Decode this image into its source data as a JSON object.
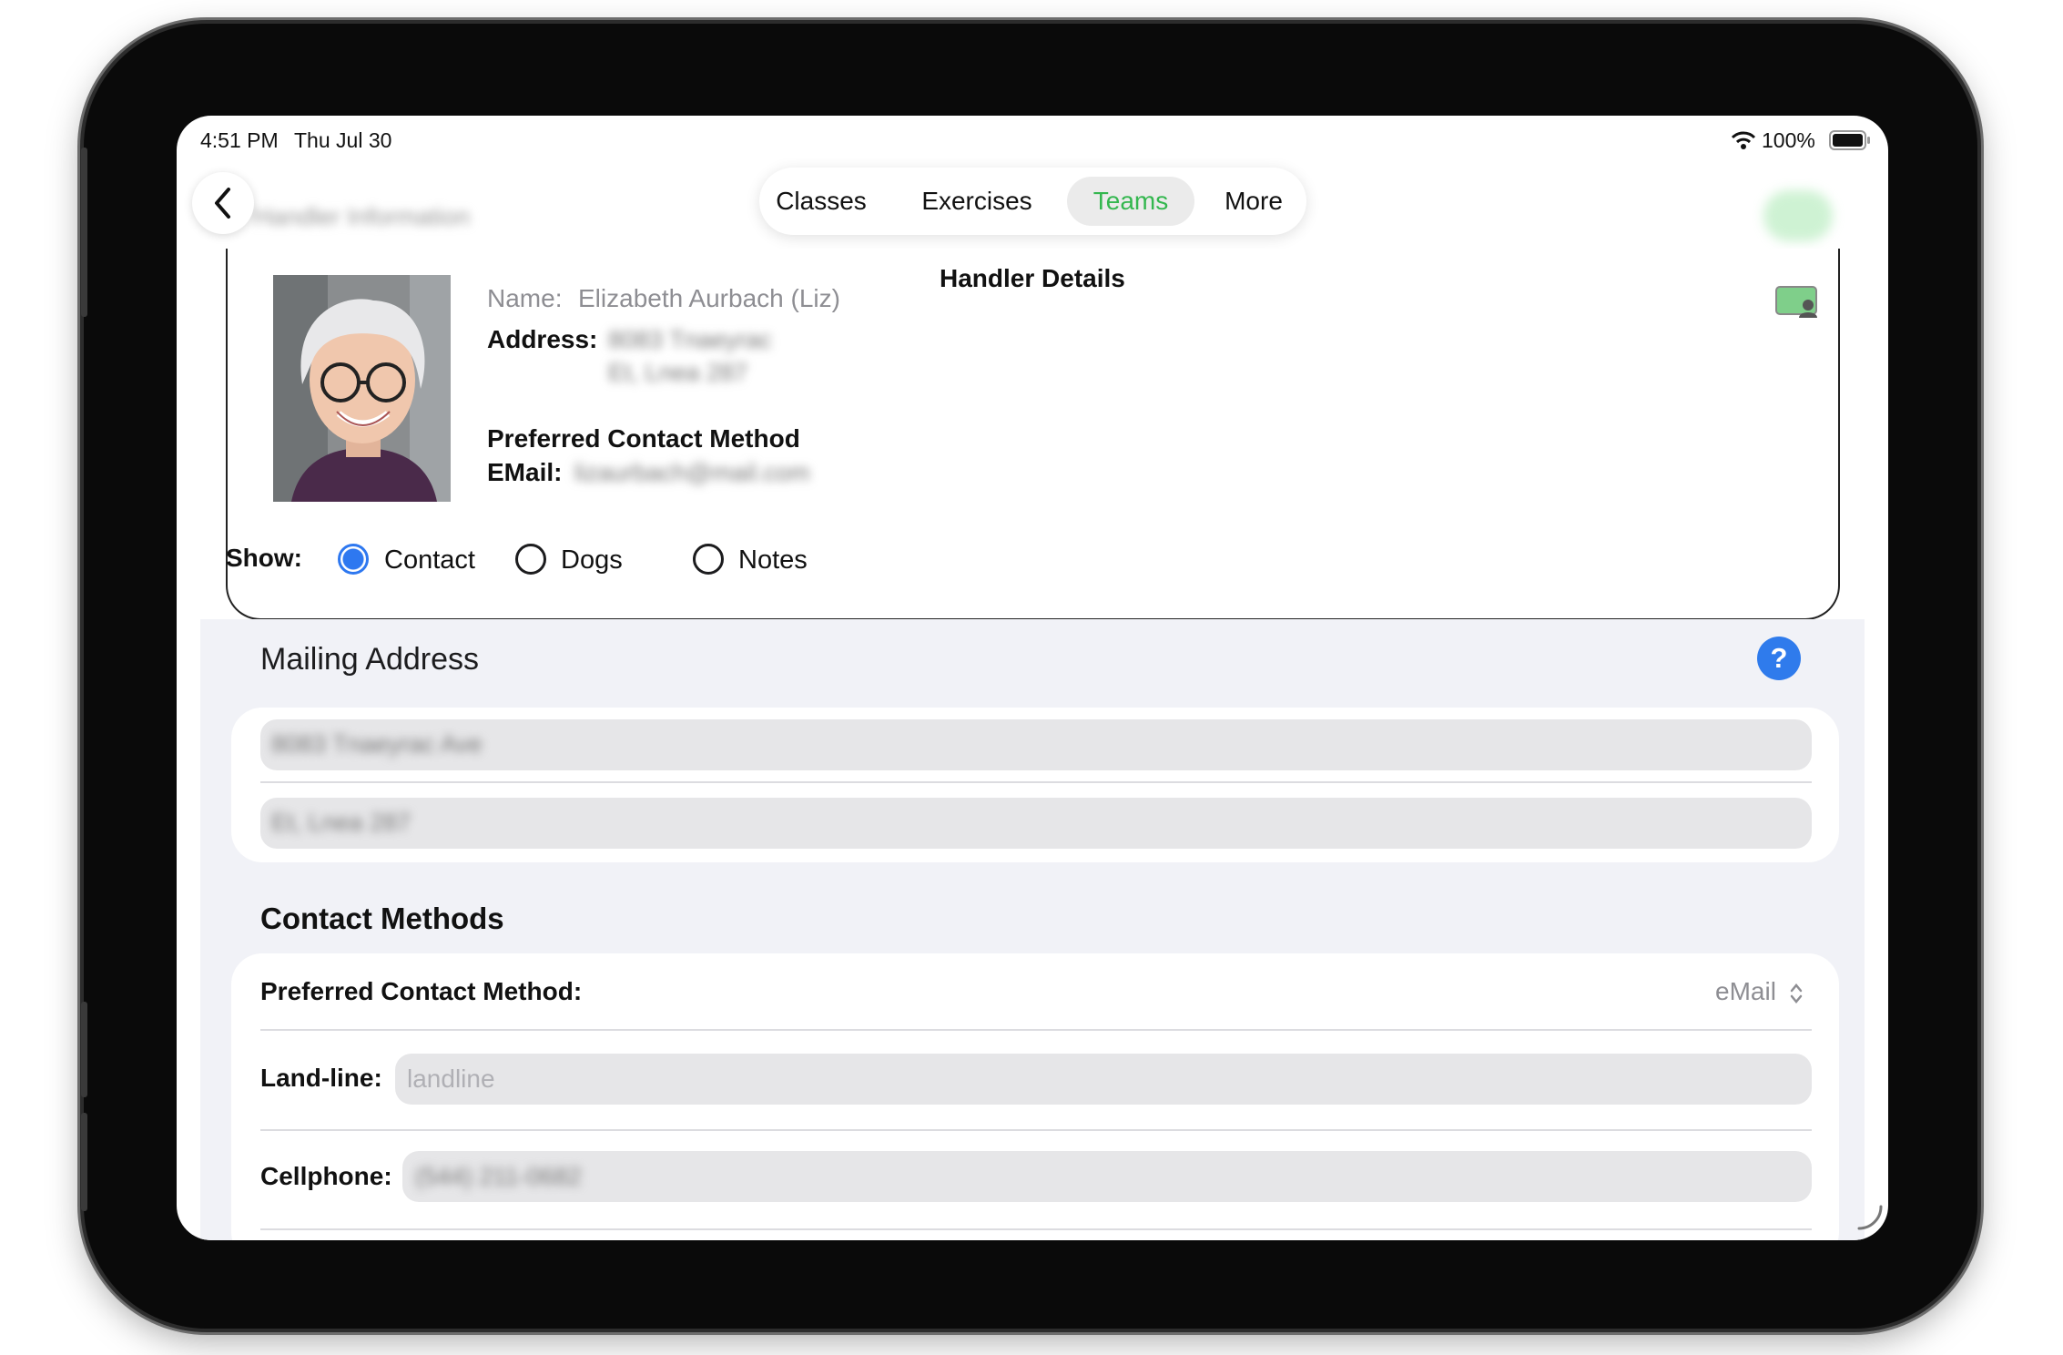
{
  "status": {
    "time": "4:51 PM",
    "date": "Thu Jul 30",
    "battery": "100%"
  },
  "nav": {
    "faded_title": "Handler Information",
    "tabs": [
      {
        "label": "Classes",
        "active": false
      },
      {
        "label": "Exercises",
        "active": false
      },
      {
        "label": "Teams",
        "active": true
      },
      {
        "label": "More",
        "active": false
      }
    ]
  },
  "handler": {
    "heading": "Handler Details",
    "name_label": "Name:",
    "name_value": "Elizabeth Aurbach  (Liz)",
    "address_label": "Address:",
    "address_line1": "8083 Tnaeyrac",
    "address_line2": "Et, Lnea 287",
    "preferred_heading": "Preferred Contact Method",
    "email_label": "EMail:",
    "email_value": "lizaurbach@mail.com"
  },
  "show": {
    "label": "Show:",
    "options": [
      {
        "label": "Contact",
        "checked": true
      },
      {
        "label": "Dogs",
        "checked": false
      },
      {
        "label": "Notes",
        "checked": false
      }
    ]
  },
  "mailing": {
    "title": "Mailing Address",
    "help": "?",
    "line1": "8083 Tnaeyrac Ave",
    "line2": "Et, Lnea 287"
  },
  "contact_methods": {
    "title": "Contact Methods",
    "preferred_label": "Preferred Contact Method:",
    "preferred_value": "eMail",
    "landline_label": "Land-line:",
    "landline_placeholder": "landline",
    "cellphone_label": "Cellphone:",
    "cellphone_value": "(544) 211-0682"
  },
  "colors": {
    "accent_green": "#34b74f",
    "radio_blue": "#2e78f0",
    "help_blue": "#2f7bec"
  }
}
